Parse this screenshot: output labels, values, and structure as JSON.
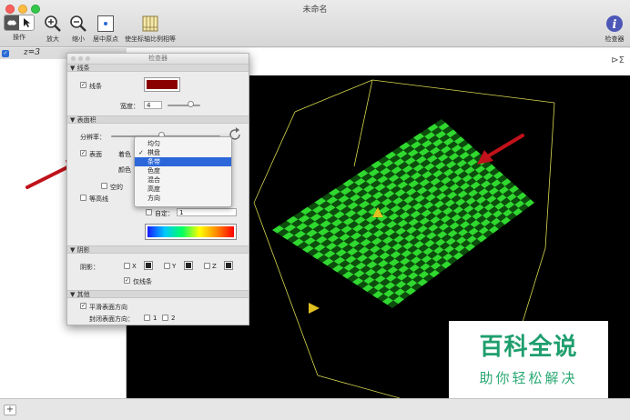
{
  "window": {
    "title": "未命名"
  },
  "toolbar": {
    "operate": "操作",
    "zoom_in": "放大",
    "zoom_out": "缩小",
    "center_origin": "居中原点",
    "equal_axes": "使坐标轴比例相等",
    "inspector": "检查器"
  },
  "expression": {
    "text": "z=3"
  },
  "inspector": {
    "title": "检查器",
    "lines_section": "线条",
    "lines_label": "线条",
    "line_color": "#8a0000",
    "width_label": "宽度：",
    "width_value": "4",
    "surface_section": "表面积",
    "resolution_label": "分辨率：",
    "surface_label": "表面",
    "shading_label": "着色",
    "color_label": "颜色",
    "hollow_label": "空的",
    "contour_label": "等高线",
    "custom_label": "自定：",
    "custom_value": "1",
    "shadow_section": "阴影",
    "shadow_label": "阴影：",
    "x": "X",
    "y": "Y",
    "z": "Z",
    "lines_only": "仅线条",
    "other_section": "其他",
    "smooth_normals": "平滑表面方向",
    "closed_normals": "封闭表面方向：",
    "opt1": "1",
    "opt2": "2"
  },
  "menu": {
    "items": [
      "均匀",
      "棋盘",
      "条带",
      "色度",
      "混合",
      "高度",
      "方向"
    ],
    "checked_index": 1,
    "highlighted_index": 2
  },
  "watermark": {
    "main": "百科全说",
    "sub": "助你轻松解决"
  },
  "colors": {
    "surface_green": "#2fd92f",
    "surface_dark": "#0d4d0d",
    "box_line": "#d8d850",
    "arrow_red": "#c0121a",
    "menu_highlight": "#2b67d9"
  }
}
